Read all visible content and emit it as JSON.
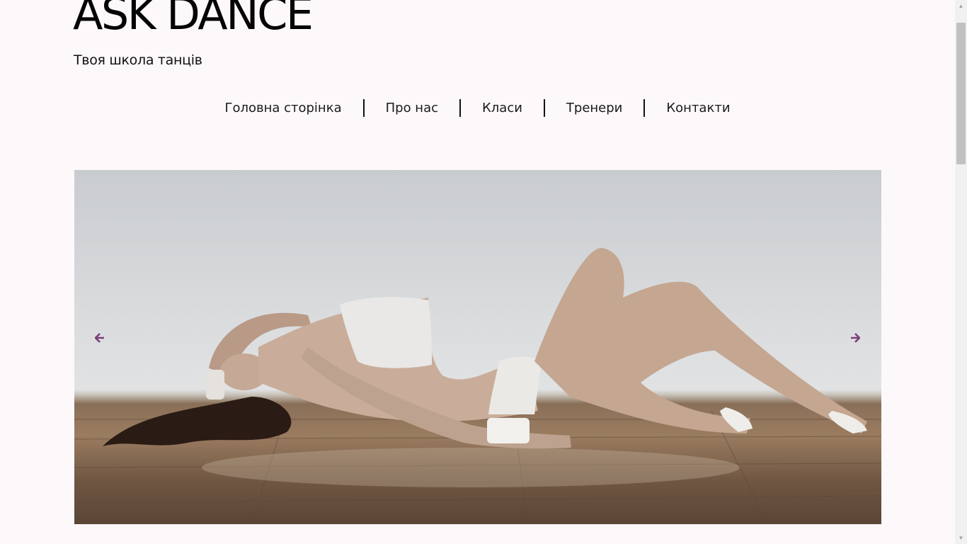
{
  "site": {
    "title": "ASK DANCE",
    "tagline": "Твоя школа танців"
  },
  "nav": {
    "items": [
      {
        "label": "Головна сторінка"
      },
      {
        "label": "Про нас"
      },
      {
        "label": "Класи"
      },
      {
        "label": "Тренери"
      },
      {
        "label": "Контакти"
      }
    ]
  },
  "slider": {
    "prev_icon": "arrow-left-icon",
    "next_icon": "arrow-right-icon",
    "arrow_color": "#7d3f7a"
  },
  "colors": {
    "background": "#fdf9fb",
    "text": "#111111",
    "accent": "#7d3f7a"
  }
}
